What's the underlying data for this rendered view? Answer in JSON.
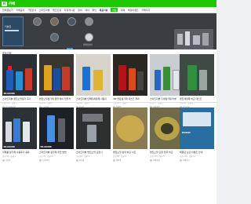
{
  "header": {
    "logo_mark": "N",
    "logo_word": "카페"
  },
  "nav": {
    "items": [
      {
        "label": "전체글보기"
      },
      {
        "label": "카페공지"
      },
      {
        "label": "가입인사"
      },
      {
        "label": "스마트리뷰"
      },
      {
        "label": "엔진오일"
      },
      {
        "label": "자유게시판"
      },
      {
        "label": "정비"
      },
      {
        "label": "세차"
      },
      {
        "label": "튜닝"
      },
      {
        "label": "제품리뷰"
      },
      {
        "label": "질문"
      },
      {
        "label": "대여"
      },
      {
        "label": "체험이벤트"
      },
      {
        "label": "카페지기"
      }
    ],
    "active_index": 10,
    "bold_index": 9
  },
  "banner": {
    "card_text": "리뷰존",
    "avatar_labels": [
      "",
      "",
      "",
      "",
      "",
      "카페리뷰어"
    ]
  },
  "section": {
    "title": "포토리뷰"
  },
  "cards_row1": [
    {
      "title": "스마트리뷰 엔진오일첨가 후기",
      "meta": "조회 120 · 댓글 5",
      "author": "자동차매니아",
      "tag": "SN-GUARD"
    },
    {
      "title": "엔진오일첨가제 정말 차이 있을까",
      "meta": "조회 98 · 댓글 3",
      "author": "드라이버",
      "tag": ""
    },
    {
      "title": "스마트리뷰 인젝터세정제 사용기",
      "meta": "조회 86 · 댓글 2",
      "author": "차사랑",
      "tag": ""
    },
    {
      "title": "3M 연료첨가제 테스트 결과",
      "meta": "조회 143 · 댓글 7",
      "author": "정비왕",
      "tag": ""
    },
    {
      "title": "스마트리뷰 디젤첨가제 리뷰",
      "meta": "조회 77 · 댓글 1",
      "author": "카페회원",
      "tag": ""
    },
    {
      "title": "엔진세정제 비교 테스트",
      "meta": "조회 64 · 댓글 0",
      "author": "오토리뷰",
      "tag": ""
    }
  ],
  "cards_row2": [
    {
      "title": "각제품 첨가제 사용후기 공유",
      "meta": "조회 55 · 댓글 2",
      "author": "리뷰어",
      "tag": "SN-GUARD"
    },
    {
      "title": "스마트리뷰 첨가제 주입 방법",
      "meta": "조회 70 · 댓글 4",
      "author": "드라이버",
      "tag": "SN-GUARD"
    },
    {
      "title": "스마트리뷰 엔진오일 교환기",
      "meta": "조회 91 · 댓글 3",
      "author": "차사랑",
      "tag": ""
    },
    {
      "title": "엔진오일 상태 비교 사진",
      "meta": "조회 88 · 댓글 6",
      "author": "정비왕",
      "tag": ""
    },
    {
      "title": "엔진오일 교환 전후 비교",
      "meta": "조회 102 · 댓글 5",
      "author": "카페회원",
      "tag": ""
    },
    {
      "title": "체험단 모집 이벤트 안내",
      "meta": "조회 210 · 댓글 12",
      "author": "카페지기",
      "tag": "EVENT"
    }
  ]
}
